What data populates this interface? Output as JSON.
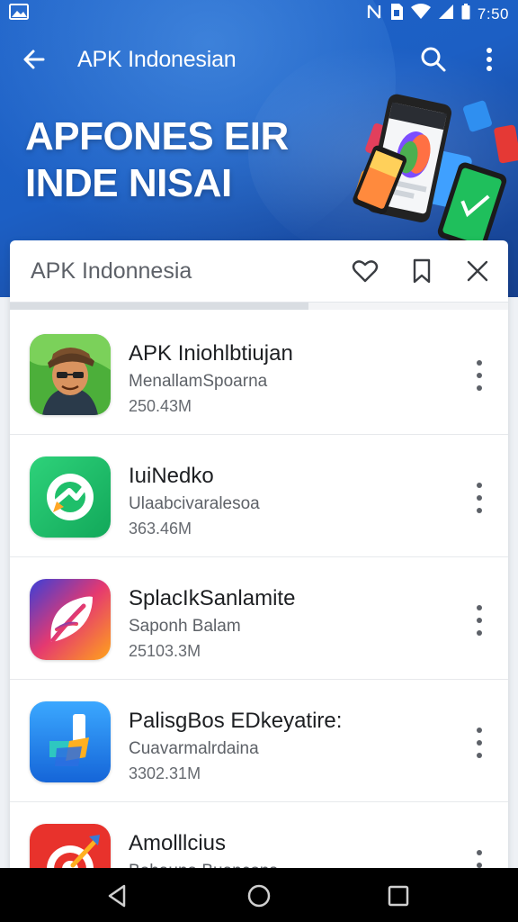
{
  "status_bar": {
    "time": "7:50",
    "icons": [
      "gallery-icon",
      "nfc-icon",
      "sim-icon",
      "wifi-icon",
      "signal-icon",
      "battery-icon"
    ]
  },
  "app_bar": {
    "title": "APK Indonesian",
    "icons": [
      "back-arrow-icon",
      "search-icon",
      "more-vert-icon"
    ]
  },
  "hero": {
    "headline_line1": "APFONES EIR",
    "headline_line2": "INDE NISAI"
  },
  "card": {
    "title": "APK Indonnesia",
    "actions": [
      "heart-icon",
      "bookmark-icon",
      "close-icon"
    ],
    "progress": 0.6
  },
  "apps": [
    {
      "name": "APK Iniohlbtiujan",
      "developer": "MenallamSpoarna",
      "size": "250.43M",
      "icon": "game-character-icon"
    },
    {
      "name": "IuiNedko",
      "developer": "Ulaabcivaralesoa",
      "size": "363.46M",
      "icon": "green-refresh-icon"
    },
    {
      "name": "SplacIkSanlamite",
      "developer": "Saponh Balam",
      "size": "25103.3M",
      "icon": "gradient-leaf-icon"
    },
    {
      "name": "PalisgBos EDkeyatire:",
      "developer": "Cuavarmalrdaina",
      "size": "3302.31M",
      "icon": "blue-shapes-icon"
    },
    {
      "name": "Amolllcius",
      "developer": "Bohauna Buancons",
      "size": "",
      "icon": "red-target-icon"
    }
  ],
  "colors": {
    "hero_blue": "#1c5fc4",
    "card_bg": "#ffffff",
    "nav_bg": "#000000"
  },
  "nav_bar": {
    "icons": [
      "back-triangle-icon",
      "home-circle-icon",
      "recents-square-icon"
    ]
  }
}
